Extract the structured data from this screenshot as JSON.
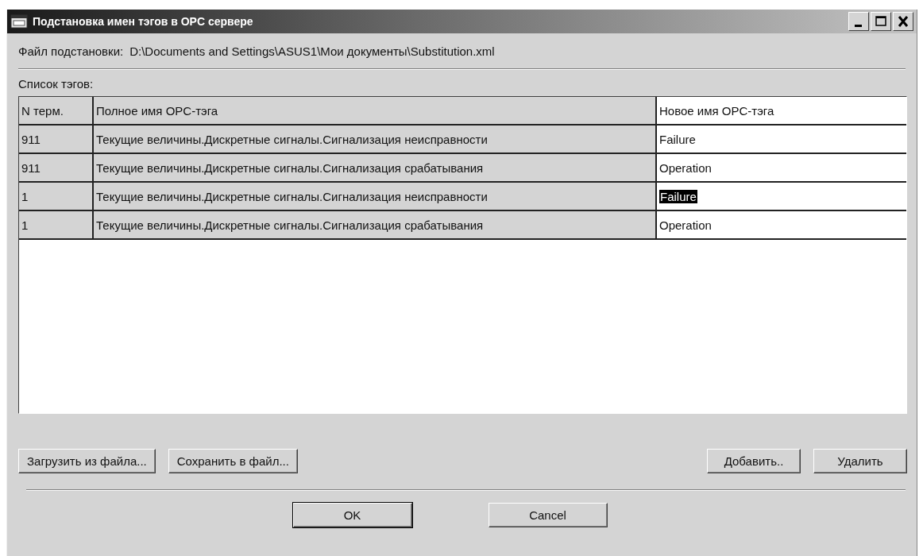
{
  "window": {
    "title": "Подстановка имен тэгов в OPC сервере"
  },
  "file_line": {
    "label": "Файл подстановки:",
    "path": "D:\\Documents and Settings\\ASUS1\\Мои документы\\Substitution.xml"
  },
  "list_label": "Список тэгов:",
  "table": {
    "columns": [
      "N терм.",
      "Полное имя OPC-тэга",
      "Новое имя OPC-тэга"
    ],
    "rows": [
      {
        "cells": [
          "911",
          "Текущие величины.Дискретные сигналы.Сигнализация неисправности",
          "Failure"
        ],
        "selected": false
      },
      {
        "cells": [
          "911",
          "Текущие величины.Дискретные сигналы.Сигнализация срабатывания",
          "Operation"
        ],
        "selected": false
      },
      {
        "cells": [
          "1",
          "Текущие величины.Дискретные сигналы.Сигнализация неисправности",
          "Failure"
        ],
        "selected": true
      },
      {
        "cells": [
          "1",
          "Текущие величины.Дискретные сигналы.Сигнализация срабатывания",
          "Operation"
        ],
        "selected": false
      }
    ]
  },
  "file_buttons": [
    "Загрузить из файла...",
    "Сохранить в файл..."
  ],
  "edit_buttons": [
    "Добавить..",
    "Удалить"
  ],
  "dialog_buttons": [
    {
      "label": "OK",
      "default": true
    },
    {
      "label": "Cancel",
      "default": false
    }
  ]
}
